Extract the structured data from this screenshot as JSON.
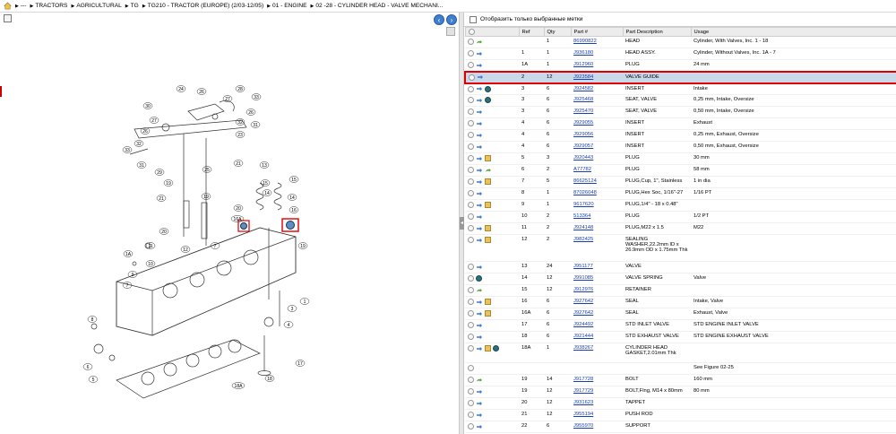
{
  "breadcrumb": [
    {
      "label": "---"
    },
    {
      "label": "TRACTORS"
    },
    {
      "label": "AGRICULTURAL"
    },
    {
      "label": "TG"
    },
    {
      "label": "TG210 - TRACTOR (EUROPE) (2/03-12/05)"
    },
    {
      "label": "01 - ENGINE"
    },
    {
      "label": "02 -28 - CYLINDER HEAD - VALVE MECHANI..."
    }
  ],
  "filter": {
    "label": "Отобразить только выбранные метки"
  },
  "table": {
    "headers": [
      "Ref",
      "Qty",
      "Part #",
      "Part Description",
      "Usage"
    ],
    "rows": [
      {
        "icons": [
          "green"
        ],
        "ref": "",
        "qty": "1",
        "part": "86990822",
        "desc": "HEAD",
        "usage": "Cylinder, With Valves, Inc. 1 - 18"
      },
      {
        "icons": [
          "blue"
        ],
        "ref": "1",
        "qty": "1",
        "part": "J936180",
        "desc": "HEAD ASSY.",
        "usage": "Cylinder, Without Valves, Inc. 1A - 7"
      },
      {
        "icons": [
          "blue"
        ],
        "ref": "1A",
        "qty": "1",
        "part": "J912960",
        "desc": "PLUG",
        "usage": "24 mm"
      },
      {
        "icons": [
          "blue"
        ],
        "ref": "2",
        "qty": "12",
        "part": "J923584",
        "desc": "VALVE GUIDE",
        "usage": "",
        "selected": true
      },
      {
        "icons": [
          "blue",
          "gear"
        ],
        "ref": "3",
        "qty": "6",
        "part": "J924582",
        "desc": "INSERT",
        "usage": "Intake"
      },
      {
        "icons": [
          "blue",
          "gear"
        ],
        "ref": "3",
        "qty": "6",
        "part": "J925468",
        "desc": "SEAT, VALVE",
        "usage": "0,25 mm, Intake, Oversize"
      },
      {
        "icons": [
          "blue"
        ],
        "ref": "3",
        "qty": "6",
        "part": "J925470",
        "desc": "SEAT, VALVE",
        "usage": "0,50 mm, Intake, Oversize"
      },
      {
        "icons": [
          "blue"
        ],
        "ref": "4",
        "qty": "6",
        "part": "J929055",
        "desc": "INSERT",
        "usage": "Exhaust"
      },
      {
        "icons": [
          "blue"
        ],
        "ref": "4",
        "qty": "6",
        "part": "J929056",
        "desc": "INSERT",
        "usage": "0,25 mm, Exhaust, Oversize"
      },
      {
        "icons": [
          "blue"
        ],
        "ref": "4",
        "qty": "6",
        "part": "J929057",
        "desc": "INSERT",
        "usage": "0,50 mm, Exhaust, Oversize"
      },
      {
        "icons": [
          "blue",
          "box"
        ],
        "ref": "5",
        "qty": "3",
        "part": "J920443",
        "desc": "PLUG",
        "usage": "30 mm"
      },
      {
        "icons": [
          "blue",
          "green"
        ],
        "ref": "6",
        "qty": "2",
        "part": "A77782",
        "desc": "PLUG",
        "usage": "58 mm"
      },
      {
        "icons": [
          "blue",
          "box"
        ],
        "ref": "7",
        "qty": "5",
        "part": "86625124",
        "desc": "PLUG,Cup, 1\", Stainless",
        "usage": "1 in dia"
      },
      {
        "icons": [
          "blue"
        ],
        "ref": "8",
        "qty": "1",
        "part": "87026048",
        "desc": "PLUG,Hex Soc, 1/16\"-27",
        "usage": "1/16 PT"
      },
      {
        "icons": [
          "blue",
          "box"
        ],
        "ref": "9",
        "qty": "1",
        "part": "9617620",
        "desc": "PLUG,1/4\" - 18 x 0.48\"",
        "usage": ""
      },
      {
        "icons": [
          "blue"
        ],
        "ref": "10",
        "qty": "2",
        "part": "513364",
        "desc": "PLUG",
        "usage": "1/2 PT"
      },
      {
        "icons": [
          "blue",
          "box"
        ],
        "ref": "11",
        "qty": "2",
        "part": "J924148",
        "desc": "PLUG,M22 x 1.5",
        "usage": "M22"
      },
      {
        "icons": [
          "blue",
          "box"
        ],
        "ref": "12",
        "qty": "2",
        "part": "J982425",
        "desc": "SEALING WASHER,22.2mm ID x 26.9mm OD x 1.75mm Thk",
        "usage": "",
        "tall": true
      },
      {
        "icons": [
          "blue"
        ],
        "ref": "13",
        "qty": "24",
        "part": "J951177",
        "desc": "VALVE",
        "usage": ""
      },
      {
        "icons": [
          "gear"
        ],
        "ref": "14",
        "qty": "12",
        "part": "J991085",
        "desc": "VALVE SPRING",
        "usage": "Valve"
      },
      {
        "icons": [
          "green"
        ],
        "ref": "15",
        "qty": "12",
        "part": "J912976",
        "desc": "RETAINER",
        "usage": ""
      },
      {
        "icons": [
          "blue",
          "box"
        ],
        "ref": "16",
        "qty": "6",
        "part": "J927642",
        "desc": "SEAL",
        "usage": "Intake, Valve"
      },
      {
        "icons": [
          "blue",
          "box"
        ],
        "ref": "16A",
        "qty": "6",
        "part": "J927642",
        "desc": "SEAL",
        "usage": "Exhaust, Valve"
      },
      {
        "icons": [
          "blue"
        ],
        "ref": "17",
        "qty": "6",
        "part": "J924492",
        "desc": "STD INLET VALVE",
        "usage": "STD ENGINE INLET VALVE"
      },
      {
        "icons": [
          "blue"
        ],
        "ref": "18",
        "qty": "6",
        "part": "J921444",
        "desc": "STD EXHAUST VALVE",
        "usage": "STD ENGINE EXHAUST VALVE"
      },
      {
        "icons": [
          "blue",
          "box",
          "gear"
        ],
        "ref": "18A",
        "qty": "1",
        "part": "J938267",
        "desc": "CYLINDER HEAD GASKET,2.01mm Thk",
        "usage": "",
        "tall2": true
      },
      {
        "icons": [],
        "ref": "",
        "qty": "",
        "part": "",
        "desc": "",
        "usage": "See Figure 02-25"
      },
      {
        "icons": [
          "green"
        ],
        "ref": "19",
        "qty": "14",
        "part": "J917728",
        "desc": "BOLT",
        "usage": "160 mm"
      },
      {
        "icons": [
          "blue"
        ],
        "ref": "19",
        "qty": "12",
        "part": "J917729",
        "desc": "BOLT,Flng, M14 x 80mm",
        "usage": "80 mm"
      },
      {
        "icons": [
          "blue"
        ],
        "ref": "20",
        "qty": "12",
        "part": "J931623",
        "desc": "TAPPET",
        "usage": ""
      },
      {
        "icons": [
          "blue"
        ],
        "ref": "21",
        "qty": "12",
        "part": "J955194",
        "desc": "PUSH ROD",
        "usage": ""
      },
      {
        "icons": [
          "blue"
        ],
        "ref": "22",
        "qty": "6",
        "part": "J955970",
        "desc": "SUPPORT",
        "usage": ""
      }
    ]
  },
  "callouts": [
    "24",
    "26",
    "27",
    "28",
    "33",
    "32",
    "30",
    "25",
    "31",
    "27",
    "26",
    "32",
    "35",
    "33",
    "26",
    "29",
    "22",
    "23",
    "13",
    "15",
    "14",
    "15",
    "21",
    "19",
    "20",
    "16",
    "16A",
    "18",
    "20",
    "17",
    "12",
    "1A",
    "11",
    "10",
    "9",
    "7",
    "1",
    "2",
    "3",
    "4",
    "8",
    "6",
    "5",
    "16A",
    "17",
    "18"
  ]
}
